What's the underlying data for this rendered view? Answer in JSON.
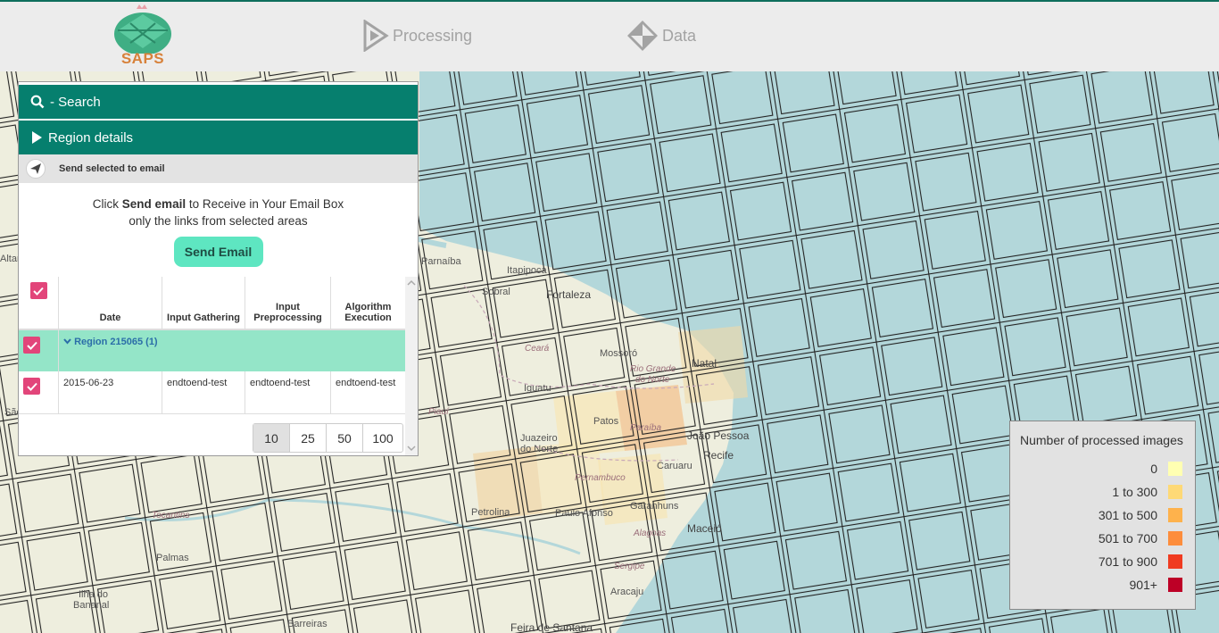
{
  "app": {
    "logo_text": "SAPS"
  },
  "nav": {
    "processing": "Processing",
    "data": "Data"
  },
  "panel": {
    "search_label": "- Search",
    "region_details_label": "Region details",
    "send_selected_label": "Send selected to email",
    "info_prefix": "Click ",
    "info_bold": "Send email",
    "info_suffix": " to Receive in Your Email Box",
    "info_line2": "only the links from selected areas",
    "send_button": "Send Email",
    "table": {
      "headers": {
        "date": "Date",
        "input_gathering": "Input Gathering",
        "input_preprocessing": "Input Preprocessing",
        "algorithm_execution": "Algorithm Execution"
      },
      "region_label": "Region 215065 (1)",
      "row": {
        "date": "2015-06-23",
        "input_gathering": "endtoend-test",
        "input_preprocessing": "endtoend-test",
        "algorithm_execution": "endtoend-test"
      }
    },
    "pager": [
      "10",
      "25",
      "50",
      "100"
    ],
    "pager_selected": "10"
  },
  "legend": {
    "title": "Number of processed images",
    "items": [
      {
        "label": "0",
        "color": "#ffffb2"
      },
      {
        "label": "1 to 300",
        "color": "#fed976"
      },
      {
        "label": "301 to 500",
        "color": "#feb24c"
      },
      {
        "label": "501 to 700",
        "color": "#fd8d3c"
      },
      {
        "label": "701 to 900",
        "color": "#f03b20"
      },
      {
        "label": "901+",
        "color": "#bd0026"
      }
    ]
  },
  "map": {
    "cities": [
      "Parnaíba",
      "Itapipoca",
      "Sobral",
      "Fortaleza",
      "Mossoró",
      "Natal",
      "Iguatu",
      "Patos",
      "João Pessoa",
      "Recife",
      "Juazeiro do Norte",
      "Caruaru",
      "Petrolina",
      "Paulo Afonso",
      "Garanhuns",
      "Maceió",
      "Palmas",
      "Aracaju",
      "Barreiras",
      "Feira de Santana",
      "Ilha do Bananal",
      "Altan",
      "São"
    ],
    "states": [
      "Ceará",
      "Rio Grande do Norte",
      "Paraíba",
      "Piauí",
      "Pernambuco",
      "Alagoas",
      "Sergipe",
      "Tocantins"
    ]
  }
}
